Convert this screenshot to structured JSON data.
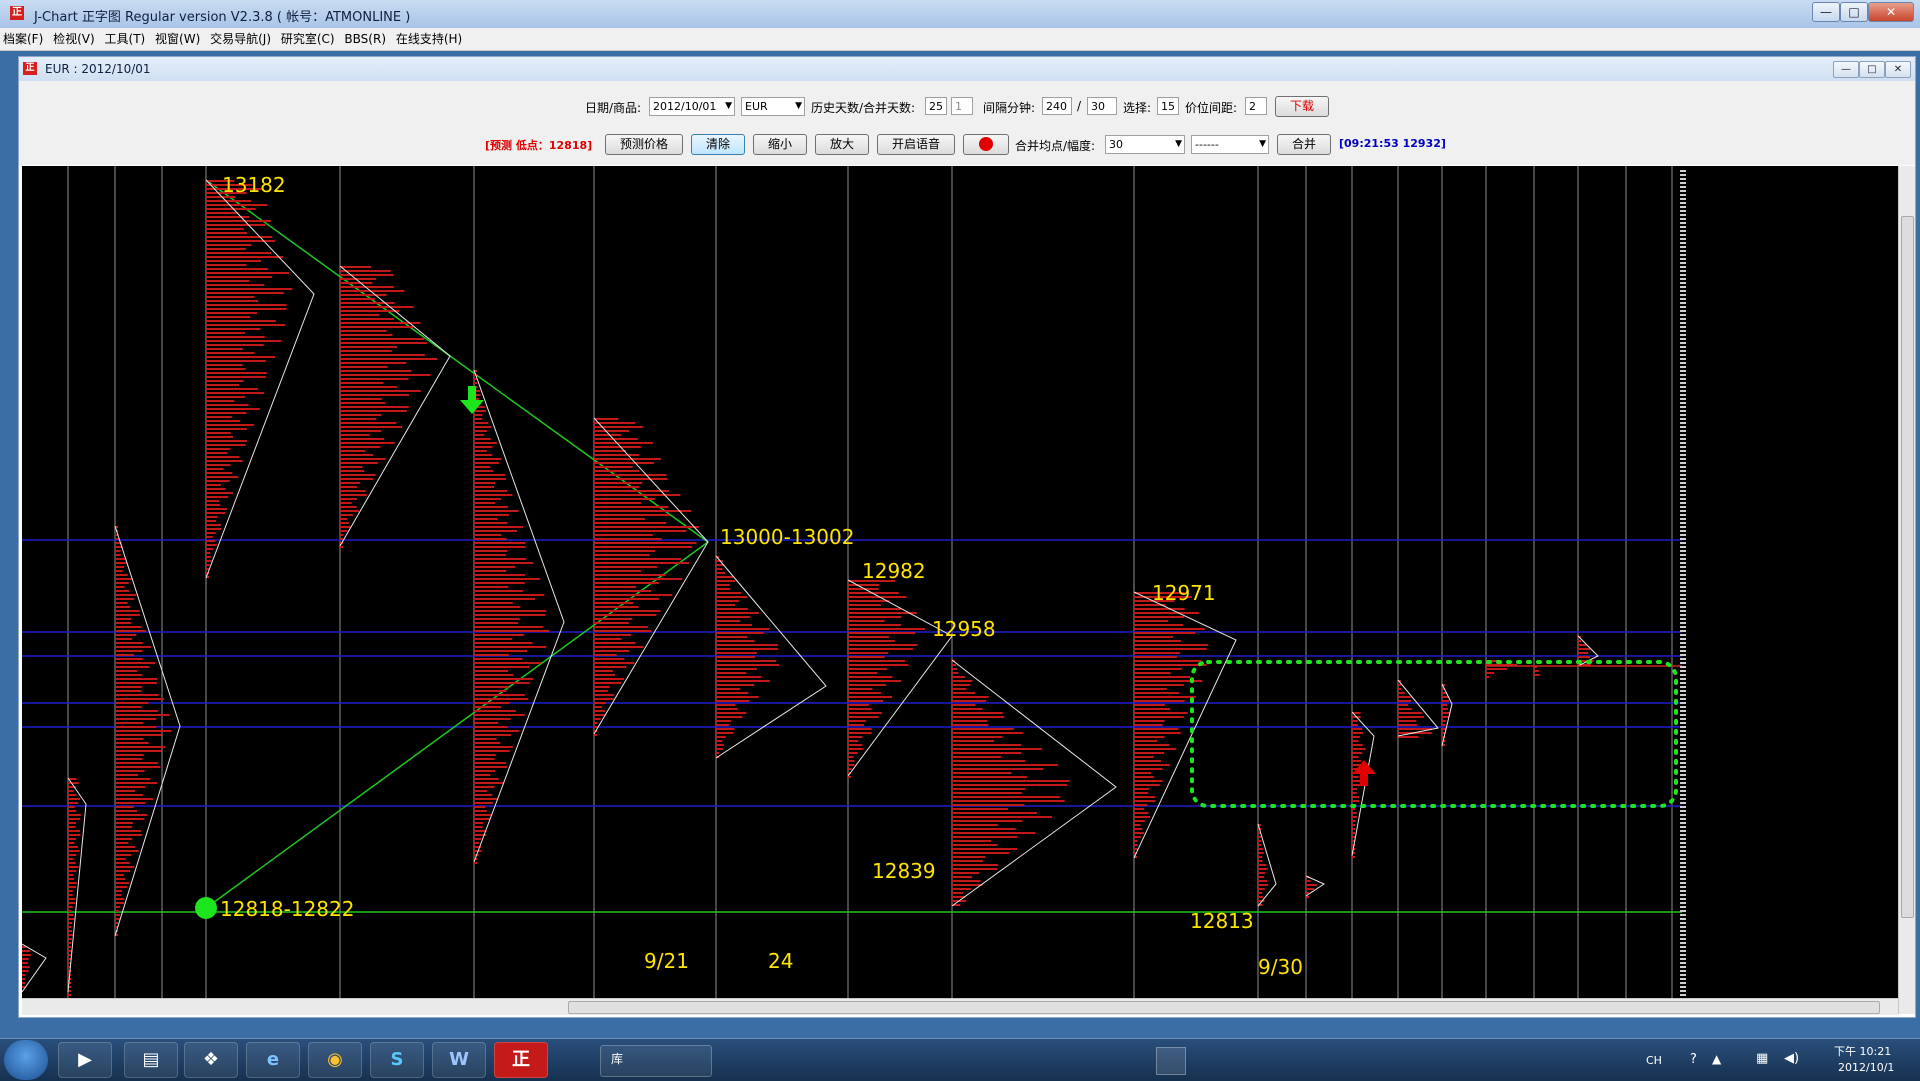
{
  "window": {
    "logo": "正",
    "title": "J-Chart 正字图  Regular version V2.3.8     ( 帐号：ATMONLINE )",
    "buttons": {
      "minimize": "—",
      "maximize": "□",
      "close": "✕"
    }
  },
  "menu": [
    "档案(F)",
    "检视(V)",
    "工具(T)",
    "视窗(W)",
    "交易导航(J)",
    "研究室(C)",
    "BBS(R)",
    "在线支持(H)"
  ],
  "subwindow": {
    "title": "EUR : 2012/10/01"
  },
  "toolbar": {
    "date_label": "日期/商品:",
    "date_value": "2012/10/01",
    "symbol_value": "EUR",
    "history_label": "历史天数/合并天数:",
    "history_days": "25",
    "merge_days": "1",
    "interval_label": "间隔分钟:",
    "interval_a": "240",
    "slash": "/",
    "interval_b": "30",
    "select_label": "选择:",
    "select_value": "15",
    "spacing_label": "价位间距:",
    "spacing_value": "2",
    "download_btn": "下载",
    "forecast_text": "[预测 低点：12818]",
    "predict_btn": "预测价格",
    "clear_btn": "清除",
    "zoomout_btn": "缩小",
    "zoomin_btn": "放大",
    "voice_btn": "开启语音",
    "merge_label": "合并均点/幅度:",
    "merge_value": "30",
    "line_style_value": "------",
    "merge_btn": "合并",
    "status_text": "[09:21:53 12932]"
  },
  "chart": {
    "annotations": [
      "13182",
      "13000-13002",
      "12982",
      "12958",
      "12971",
      "12839",
      "12813",
      "12818-12822",
      "9/21",
      "24",
      "9/30"
    ],
    "colors": {
      "profile": "#c21818",
      "annotation": "#ffe400",
      "hline": "#1f1fd0",
      "trend": "#1ec81e",
      "box": "#1ee61e",
      "divider": "#cccccc"
    }
  },
  "taskbar": {
    "apps": [
      "media-player",
      "file-explorer",
      "app-store",
      "internet-explorer",
      "chrome",
      "skype",
      "word",
      "j-chart"
    ],
    "app_glyphs": [
      "▶",
      "▤",
      "❖",
      "e",
      "◉",
      "S",
      "W",
      "正"
    ],
    "library_label": "库",
    "tray_lang": "CH",
    "clock_time": "下午 10:21",
    "clock_date": "2012/10/1"
  }
}
